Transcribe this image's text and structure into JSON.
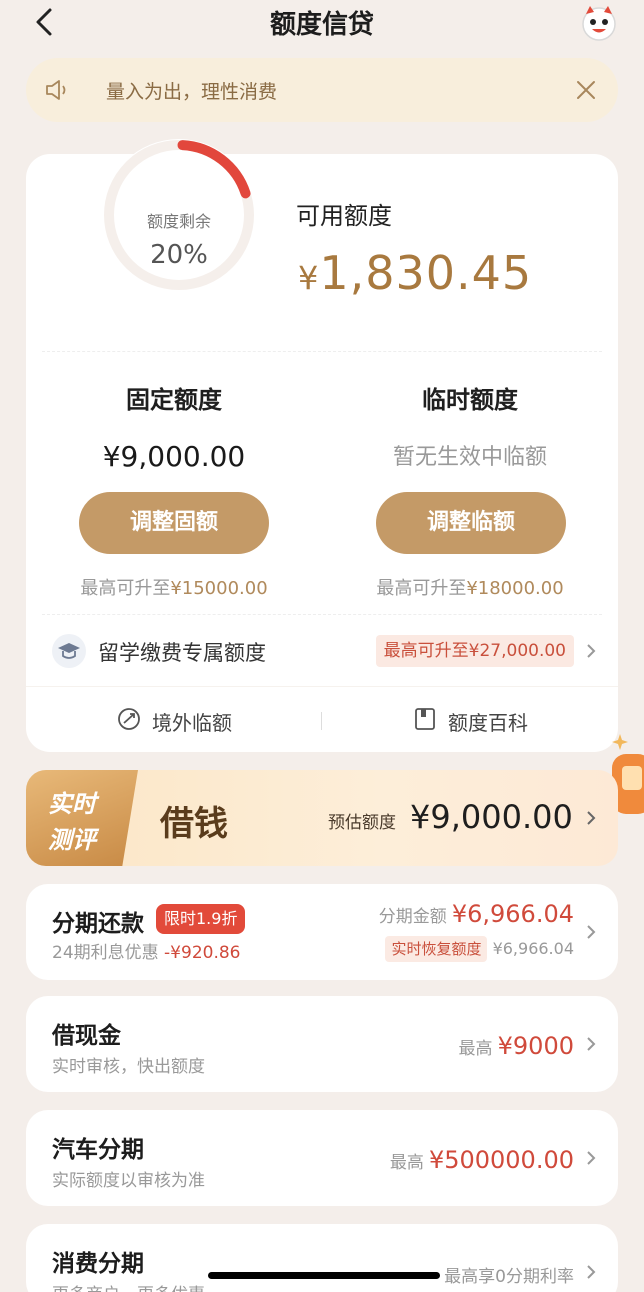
{
  "header": {
    "title": "额度信贷"
  },
  "notice": {
    "text": "量入为出，理性消费"
  },
  "quota": {
    "ring_label": "额度剩余",
    "ring_percent": "20%",
    "ring_fraction": 0.2,
    "available_label": "可用额度",
    "available_currency": "¥",
    "available_amount": "1,830.45",
    "fixed": {
      "title": "固定额度",
      "value": "¥9,000.00",
      "button": "调整固额",
      "max_prefix": "最高可升至",
      "max_value": "¥15000.00"
    },
    "temp": {
      "title": "临时额度",
      "value": "暂无生效中临额",
      "button": "调整临额",
      "max_prefix": "最高可升至",
      "max_value": "¥18000.00"
    },
    "study": {
      "label": "留学缴费专属额度",
      "tag": "最高可升至¥27,000.00"
    },
    "links": {
      "overseas": "境外临额",
      "wiki": "额度百科"
    }
  },
  "borrow": {
    "badge_line1": "实时",
    "badge_line2": "测评",
    "name": "借钱",
    "estimate_label": "预估额度",
    "estimate_amount": "¥9,000.00"
  },
  "items": {
    "installment": {
      "title": "分期还款",
      "tag": "限时1.9折",
      "sub_prefix": "24期利息优惠",
      "sub_value": "-¥920.86",
      "amount_label": "分期金额",
      "amount": "¥6,966.04",
      "restore_label": "实时恢复额度",
      "restore_value": "¥6,966.04"
    },
    "cash": {
      "title": "借现金",
      "sub": "实时审核，快出额度",
      "label": "最高",
      "value": "¥9000"
    },
    "car": {
      "title": "汽车分期",
      "sub": "实际额度以审核为准",
      "label": "最高",
      "value": "¥500000.00"
    },
    "consume": {
      "title": "消费分期",
      "sub": "更多商户，更多优惠",
      "right": "最高享0分期利率"
    }
  },
  "colors": {
    "accent": "#c49a67",
    "amount_gold": "#a8793f",
    "red": "#d04a3b",
    "ring_red": "#e2473c"
  }
}
